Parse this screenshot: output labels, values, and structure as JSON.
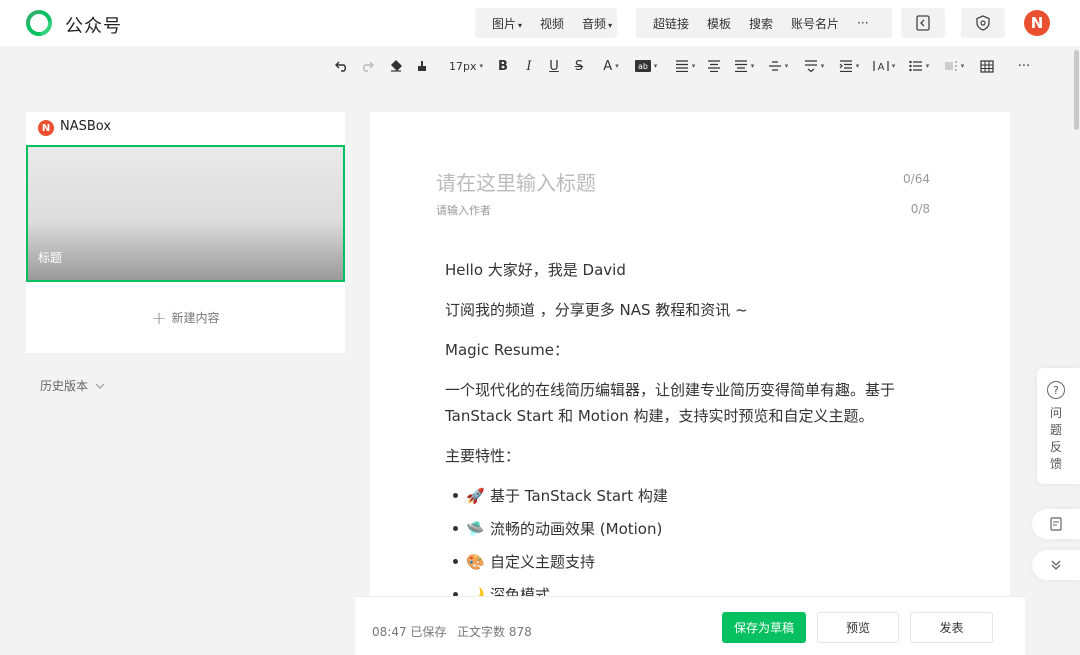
{
  "app": {
    "title": "公众号",
    "brand_color": "#07c160",
    "avatar_letter": "N",
    "avatar_color": "#e8502f"
  },
  "topnav": {
    "media_group": [
      {
        "label": "图片",
        "has_caret": true
      },
      {
        "label": "视频",
        "has_caret": false
      },
      {
        "label": "音频",
        "has_caret": true
      }
    ],
    "tools_group": [
      {
        "label": "超链接"
      },
      {
        "label": "模板"
      },
      {
        "label": "搜索"
      },
      {
        "label": "账号名片"
      },
      {
        "label": "···"
      }
    ],
    "icons": [
      "insert-page-icon",
      "shield-icon"
    ]
  },
  "toolbar": {
    "font_size": "17px",
    "bold": "B",
    "italic": "I",
    "underline": "U",
    "strike": "S",
    "font_color": "A",
    "more": "···"
  },
  "left_panel": {
    "account_name": "NASBox",
    "cover_title": "标题",
    "new_content": "新建内容",
    "history": "历史版本"
  },
  "editor": {
    "title_placeholder": "请在这里输入标题",
    "title_count": "0/64",
    "author_placeholder": "请输入作者",
    "author_count": "0/8",
    "paragraphs": [
      "Hello 大家好，我是 David",
      "订阅我的频道 ，分享更多 NAS 教程和资讯 ~",
      "Magic Resume：",
      "一个现代化的在线简历编辑器，让创建专业简历变得简单有趣。基于 TanStack Start 和 Motion 构建，支持实时预览和自定义主题。",
      "主要特性："
    ],
    "list_items": [
      {
        "emoji": "🚀",
        "text": "基于 TanStack Start 构建"
      },
      {
        "emoji": "🛸",
        "text": "流畅的动画效果 (Motion)"
      },
      {
        "emoji": "🎨",
        "text": "自定义主题支持"
      },
      {
        "emoji": "🌙",
        "text": "深色模式"
      }
    ]
  },
  "footer": {
    "save_status": "08:47 已保存",
    "word_count": "正文字数 878",
    "save_draft": "保存为草稿",
    "preview": "预览",
    "publish": "发表"
  },
  "side": {
    "feedback": "问题反馈"
  }
}
